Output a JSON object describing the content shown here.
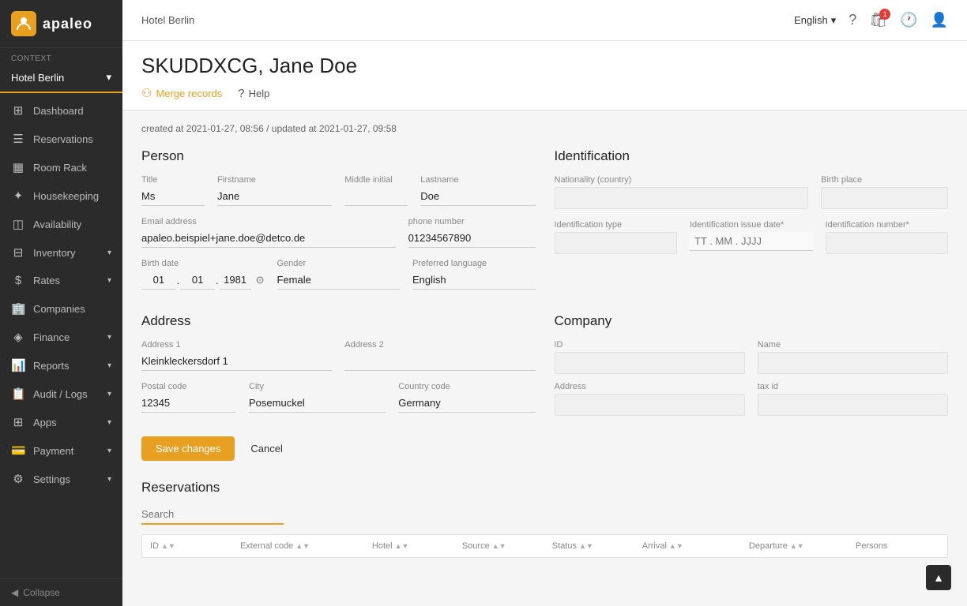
{
  "sidebar": {
    "logo_letter": "A",
    "logo_text": "apaleo",
    "context_label": "Context",
    "hotel_name": "Hotel Berlin",
    "items": [
      {
        "id": "dashboard",
        "icon": "⊞",
        "label": "Dashboard",
        "has_arrow": false
      },
      {
        "id": "reservations",
        "icon": "☰",
        "label": "Reservations",
        "has_arrow": false
      },
      {
        "id": "room-rack",
        "icon": "📅",
        "label": "Room Rack",
        "has_arrow": false
      },
      {
        "id": "housekeeping",
        "icon": "🧹",
        "label": "Housekeeping",
        "has_arrow": false
      },
      {
        "id": "availability",
        "icon": "◫",
        "label": "Availability",
        "has_arrow": false
      },
      {
        "id": "inventory",
        "icon": "📦",
        "label": "Inventory",
        "has_arrow": true
      },
      {
        "id": "rates",
        "icon": "💲",
        "label": "Rates",
        "has_arrow": true
      },
      {
        "id": "companies",
        "icon": "🏢",
        "label": "Companies",
        "has_arrow": false
      },
      {
        "id": "finance",
        "icon": "💰",
        "label": "Finance",
        "has_arrow": true
      },
      {
        "id": "reports",
        "icon": "📊",
        "label": "Reports",
        "has_arrow": true
      },
      {
        "id": "audit-logs",
        "icon": "📋",
        "label": "Audit / Logs",
        "has_arrow": true
      },
      {
        "id": "apps",
        "icon": "⊞",
        "label": "Apps",
        "has_arrow": true
      },
      {
        "id": "payment",
        "icon": "💳",
        "label": "Payment",
        "has_arrow": true
      },
      {
        "id": "settings",
        "icon": "⚙",
        "label": "Settings",
        "has_arrow": true
      }
    ],
    "collapse_label": "Collapse"
  },
  "topbar": {
    "hotel": "Hotel Berlin",
    "language": "English",
    "notification_count": "1"
  },
  "page": {
    "title": "SKUDDXCG, Jane Doe",
    "merge_records_label": "Merge records",
    "help_label": "Help",
    "meta": "created at 2021-01-27, 08:56 / updated at 2021-01-27, 09:58"
  },
  "person": {
    "section_title": "Person",
    "title_label": "Title",
    "title_value": "Ms",
    "firstname_label": "Firstname",
    "firstname_value": "Jane",
    "middle_initial_label": "Middle initial",
    "middle_initial_value": "",
    "lastname_label": "Lastname",
    "lastname_value": "Doe",
    "email_label": "Email address",
    "email_value": "apaleo.beispiel+jane.doe@detco.de",
    "phone_label": "phone number",
    "phone_value": "01234567890",
    "birth_date_label": "Birth date",
    "birth_date_d": "01",
    "birth_date_m": "01",
    "birth_date_y": "1981",
    "gender_label": "Gender",
    "gender_value": "Female",
    "preferred_language_label": "Preferred language",
    "preferred_language_value": "English"
  },
  "identification": {
    "section_title": "Identification",
    "nationality_label": "Nationality (country)",
    "nationality_value": "",
    "birth_place_label": "Birth place",
    "birth_place_value": "",
    "id_type_label": "Identification type",
    "id_type_value": "",
    "id_issue_date_label": "Identification issue date*",
    "id_issue_date_placeholder": "TT . MM . JJJJ",
    "id_number_label": "Identification number*",
    "id_number_value": ""
  },
  "address": {
    "section_title": "Address",
    "address1_label": "Address 1",
    "address1_value": "Kleinkleckersdorf 1",
    "address2_label": "Address 2",
    "address2_value": "",
    "postal_code_label": "Postal code",
    "postal_code_value": "12345",
    "city_label": "City",
    "city_value": "Posemuckel",
    "country_code_label": "Country code",
    "country_code_value": "Germany"
  },
  "company": {
    "section_title": "Company",
    "id_label": "ID",
    "id_value": "",
    "name_label": "Name",
    "name_value": "",
    "address_label": "Address",
    "address_value": "",
    "tax_id_label": "tax id",
    "tax_id_value": ""
  },
  "buttons": {
    "save_label": "Save changes",
    "cancel_label": "Cancel"
  },
  "reservations": {
    "section_title": "Reservations",
    "search_placeholder": "Search",
    "columns": [
      "ID",
      "External code",
      "Hotel",
      "Source",
      "Status",
      "Arrival",
      "Departure",
      "Persons"
    ]
  }
}
